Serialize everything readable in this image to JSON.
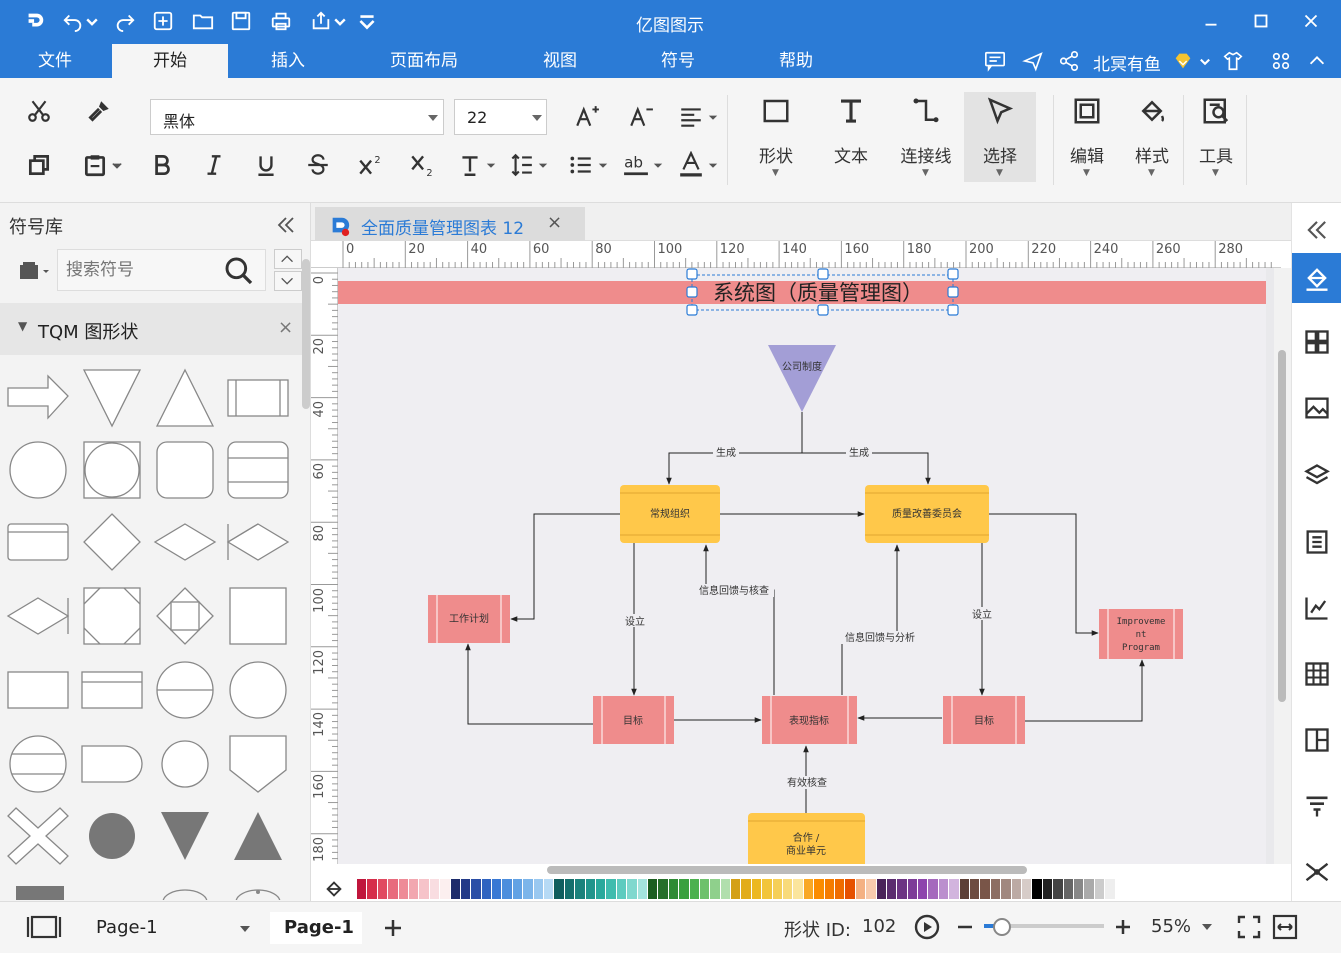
{
  "app": {
    "title": "亿图图示"
  },
  "menu": {
    "file": "文件",
    "start": "开始",
    "insert": "插入",
    "layout": "页面布局",
    "view": "视图",
    "symbol": "符号",
    "help": "帮助"
  },
  "account": {
    "user": "北冥有鱼"
  },
  "ribbon": {
    "font_family": "黑体",
    "font_size": "22",
    "shape": "形状",
    "text": "文本",
    "connector": "连接线",
    "select": "选择",
    "edit": "编辑",
    "style": "样式",
    "tools": "工具"
  },
  "library": {
    "title": "符号库",
    "search_placeholder": "搜索符号",
    "group": "TQM 图形状"
  },
  "document": {
    "tab": "全面质量管理图表 12"
  },
  "ruler": {
    "h": [
      "0",
      "20",
      "40",
      "60",
      "80",
      "100",
      "120",
      "140",
      "160",
      "180",
      "200",
      "220",
      "240",
      "260",
      "280"
    ],
    "v": [
      "0",
      "20",
      "40",
      "60",
      "80",
      "100",
      "120",
      "140",
      "160",
      "180"
    ]
  },
  "diagram": {
    "title": "系统图（质量管理图）",
    "nodes": {
      "company": "公司制度",
      "org": "常规组织",
      "committee": "质量改善委员会",
      "plan": "工作计划",
      "improve1": "Improveme",
      "improve2": "nt",
      "improve3": "Program",
      "goal_left": "目标",
      "indicator": "表现指标",
      "goal_right": "目标",
      "coop1": "合作 /",
      "coop2": "商业单元"
    },
    "labels": {
      "gen1": "生成",
      "gen2": "生成",
      "feedback_check": "信息回馈与核查",
      "set_left": "设立",
      "feedback_analysis": "信息回馈与分析",
      "set_right": "设立",
      "verify": "有效核查"
    }
  },
  "status": {
    "page_select": "Page-1",
    "page_tab": "Page-1",
    "shape_id_label": "形状 ID:",
    "shape_id": "102",
    "zoom": "55%"
  },
  "colors": {
    "accent": "#2b7bd6",
    "title_bar": "#ef8c8c",
    "yellow_node": "#ffc84a",
    "red_node": "#ef8c8c",
    "purple_node": "#a39ed6",
    "canvas_bg": "#efeef2"
  },
  "palette": [
    "#c0163c",
    "#d62d4a",
    "#e14a61",
    "#e86b7d",
    "#ee8b97",
    "#f2a7b0",
    "#f6c3c9",
    "#f9dde1",
    "#fcefef",
    "#1d2c6b",
    "#223a88",
    "#2a4ea6",
    "#2f63c0",
    "#3878d4",
    "#4c8edd",
    "#62a2e4",
    "#7cb5ea",
    "#99c8f0",
    "#b6daf5",
    "#0f5e5e",
    "#146f6c",
    "#1a827c",
    "#20958c",
    "#29a99c",
    "#3fbcae",
    "#5dcbbf",
    "#7fd8ce",
    "#a3e4dd",
    "#1b5e20",
    "#256f2a",
    "#2e8b34",
    "#3aa03f",
    "#4cb14f",
    "#6dc16c",
    "#8fd08c",
    "#b1dfad",
    "#d4a017",
    "#e2ac1a",
    "#ecb820",
    "#f2c53a",
    "#f5cf58",
    "#f8da7a",
    "#fbe59d",
    "#f9a825",
    "#fb8c00",
    "#f57c00",
    "#ef6c00",
    "#e65100",
    "#f4b183",
    "#f8cbad",
    "#4a235a",
    "#5b2c6f",
    "#6c3483",
    "#7d3c98",
    "#8e44ad",
    "#a569bd",
    "#bb8fce",
    "#d2b4de",
    "#5d4037",
    "#6d4c41",
    "#795548",
    "#8d6e63",
    "#a1887f",
    "#bcaaa4",
    "#d7ccc8",
    "#000000",
    "#222222",
    "#444444",
    "#666666",
    "#888888",
    "#aaaaaa",
    "#cccccc",
    "#eeeeee"
  ]
}
